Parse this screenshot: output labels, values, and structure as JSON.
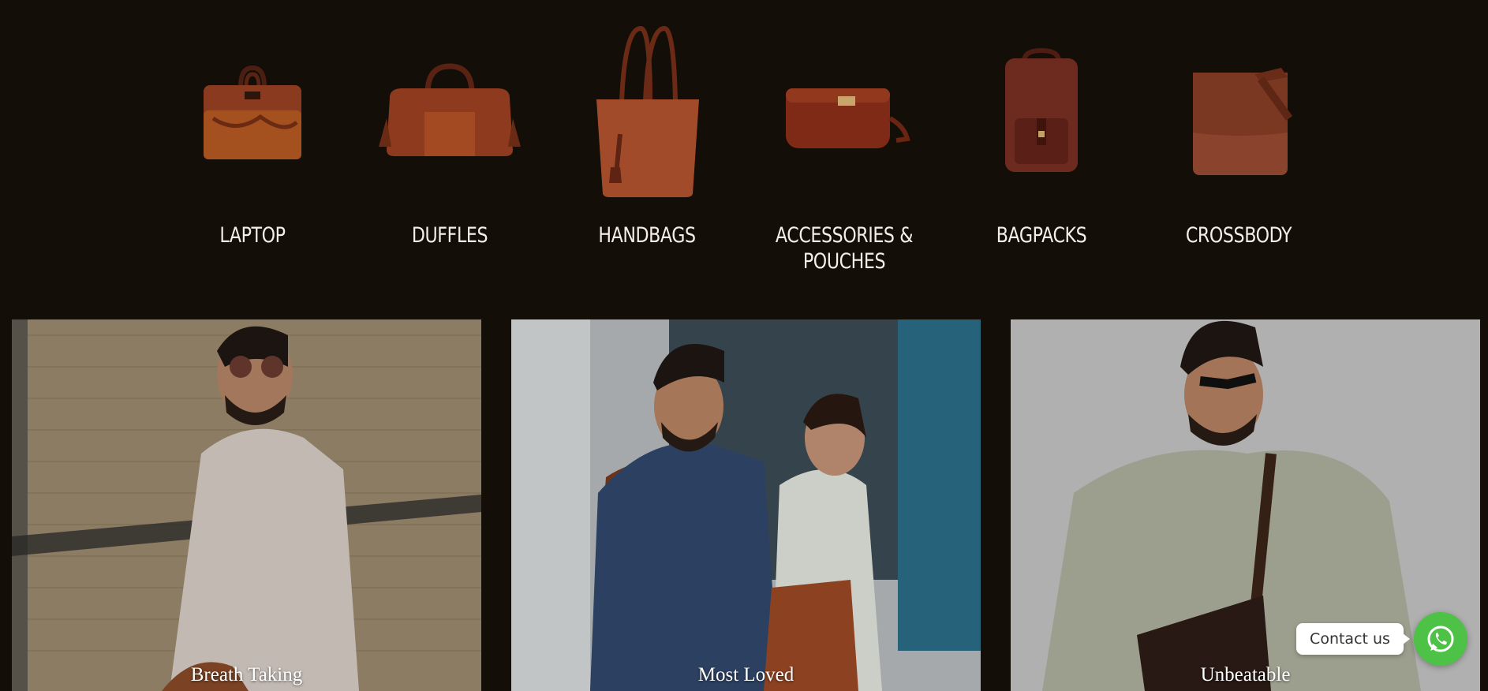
{
  "categories": [
    {
      "label": "LAPTOP",
      "icon": "laptop-bag-icon"
    },
    {
      "label": "DUFFLES",
      "icon": "duffle-bag-icon"
    },
    {
      "label": "HANDBAGS",
      "icon": "tote-handbag-icon"
    },
    {
      "label": "ACCESSORIES & POUCHES",
      "icon": "pouch-icon"
    },
    {
      "label": "BAGPACKS",
      "icon": "backpack-icon"
    },
    {
      "label": "CROSSBODY",
      "icon": "messenger-bag-icon"
    }
  ],
  "tiles": [
    {
      "caption": "Breath Taking"
    },
    {
      "caption": "Most Loved"
    },
    {
      "caption": "Unbeatable"
    }
  ],
  "contact": {
    "label": "Contact us",
    "icon": "whatsapp-icon"
  },
  "colors": {
    "background": "#130e07",
    "leather": "#8a3a22",
    "whatsapp": "#4dc247"
  }
}
